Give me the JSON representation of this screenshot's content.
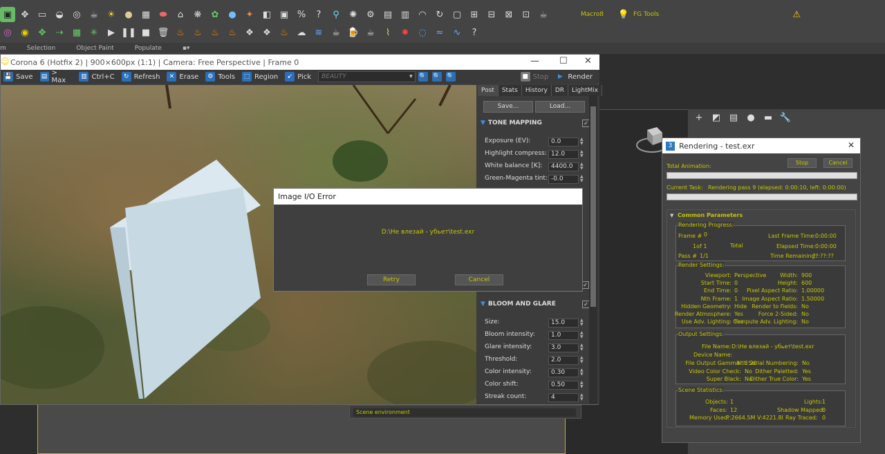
{
  "toolbar": {
    "ribbon": [
      "m",
      "Selection",
      "Object Paint",
      "Populate",
      "▪▾"
    ],
    "macro_label": "Macro8",
    "fg_label": "FG Tools"
  },
  "vfb": {
    "title": "Corona 6 (Hotfix 2) | 900×600px (1:1) | Camera: Free Perspective | Frame 0",
    "tools": {
      "save": "Save",
      "max": "> Max",
      "ctrlc": "Ctrl+C",
      "refresh": "Refresh",
      "erase": "Erase",
      "tools": "Tools",
      "region": "Region",
      "pick": "Pick",
      "beauty": "BEAUTY",
      "stop": "Stop",
      "render": "Render"
    },
    "tabs": [
      "Post",
      "Stats",
      "History",
      "DR",
      "LightMix"
    ],
    "save_btn": "Save...",
    "load_btn": "Load...",
    "tone_mapping": {
      "title": "TONE MAPPING",
      "rows": [
        {
          "label": "Exposure (EV):",
          "value": "0.0"
        },
        {
          "label": "Highlight compress:",
          "value": "12.0"
        },
        {
          "label": "White balance [K]:",
          "value": "4400.0"
        },
        {
          "label": "Green-Magenta tint:",
          "value": "-0.0"
        }
      ]
    },
    "bloom_glare": {
      "title": "BLOOM AND GLARE",
      "rows": [
        {
          "label": "Size:",
          "value": "15.0"
        },
        {
          "label": "Bloom intensity:",
          "value": "1.0"
        },
        {
          "label": "Glare intensity:",
          "value": "3.0"
        },
        {
          "label": "Threshold:",
          "value": "2.0"
        },
        {
          "label": "Color intensity:",
          "value": "0.30"
        },
        {
          "label": "Color shift:",
          "value": "0.50"
        },
        {
          "label": "Streak count:",
          "value": "4"
        }
      ]
    }
  },
  "error_dialog": {
    "title": "Image I/O Error",
    "message": "D:\\Не влезай - убьет\\test.exr",
    "retry": "Retry",
    "cancel": "Cancel"
  },
  "scene_env": "Scene environment",
  "render_dialog": {
    "title": "Rendering - test.exr",
    "total_animation": "Total Animation:",
    "stop": "Stop",
    "cancel": "Cancel",
    "current_task_label": "Current Task:",
    "current_task": "Rendering pass 9 (elapsed: 0:00:10, left: 0:00:00)",
    "common_params": "Common Parameters",
    "progress": {
      "title": "Rendering Progress:",
      "frame_label": "Frame #",
      "frame_val": "0",
      "of": "1of 1",
      "total": "Total",
      "pass_label": "Pass #",
      "pass_val": "1/1",
      "last_frame_time": "Last Frame Time:",
      "last_frame_val": "0:00:00",
      "elapsed_time": "Elapsed Time:",
      "elapsed_val": "0:00:00",
      "time_remaining": "Time Remaining:",
      "remaining_val": "??:??:??"
    },
    "render_settings": {
      "title": "Render Settings:",
      "left": [
        {
          "k": "Viewport:",
          "v": "Perspective"
        },
        {
          "k": "Start Time:",
          "v": "0"
        },
        {
          "k": "End Time:",
          "v": "0"
        },
        {
          "k": "Nth Frame:",
          "v": "1"
        },
        {
          "k": "Hidden Geometry:",
          "v": "Hide"
        },
        {
          "k": "Render Atmosphere:",
          "v": "Yes"
        },
        {
          "k": "Use Adv. Lighting:",
          "v": "Yes"
        }
      ],
      "right": [
        {
          "k": "Width:",
          "v": "900"
        },
        {
          "k": "Height:",
          "v": "600"
        },
        {
          "k": "Pixel Aspect Ratio:",
          "v": "1.00000"
        },
        {
          "k": "Image Aspect Ratio:",
          "v": "1.50000"
        },
        {
          "k": "Render to Fields:",
          "v": "No"
        },
        {
          "k": "Force 2-Sided:",
          "v": "No"
        },
        {
          "k": "Compute Adv. Lighting:",
          "v": "No"
        }
      ]
    },
    "output_settings": {
      "title": "Output Settings:",
      "file_name_label": "File Name:",
      "file_name": "D:\\Не влезай - убьет\\test.exr",
      "device_name_label": "Device Name:",
      "left": [
        {
          "k": "File Output Gamma:",
          "v": "2.20"
        },
        {
          "k": "Video Color Check:",
          "v": "No"
        },
        {
          "k": "Super Black:",
          "v": "No"
        }
      ],
      "right": [
        {
          "k": "Nth Serial Numbering:",
          "v": "No"
        },
        {
          "k": "Dither Paletted:",
          "v": "Yes"
        },
        {
          "k": "Dither True Color:",
          "v": "Yes"
        }
      ]
    },
    "scene_stats": {
      "title": "Scene Statistics:",
      "objects_label": "Objects:",
      "objects": "1",
      "faces_label": "Faces:",
      "faces": "12",
      "memory_label": "Memory Used:",
      "memory": "P:2664.5M V:4221.8I",
      "lights_label": "Lights:",
      "lights": "1",
      "shadow_label": "Shadow Mapped:",
      "shadow": "0",
      "ray_label": "Ray Traced:",
      "ray": "0"
    }
  }
}
